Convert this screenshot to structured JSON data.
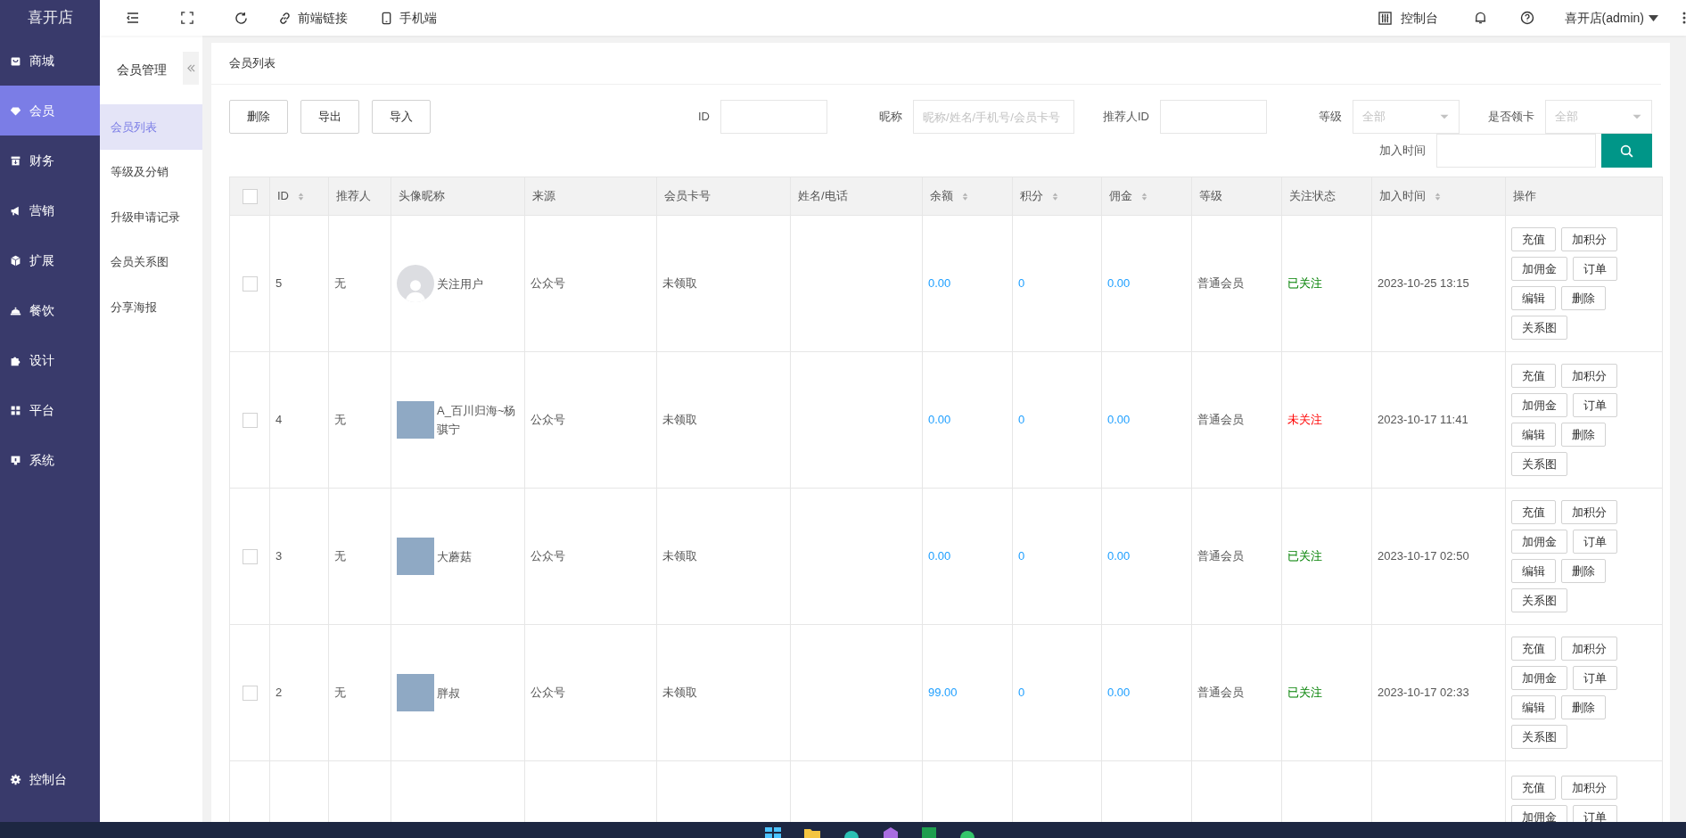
{
  "sidebar": {
    "logo": "喜开店",
    "items": [
      {
        "label": "商城",
        "selected": false
      },
      {
        "label": "会员",
        "selected": true
      },
      {
        "label": "财务",
        "selected": false
      },
      {
        "label": "营销",
        "selected": false
      },
      {
        "label": "扩展",
        "selected": false
      },
      {
        "label": "餐饮",
        "selected": false
      },
      {
        "label": "设计",
        "selected": false
      },
      {
        "label": "平台",
        "selected": false
      },
      {
        "label": "系统",
        "selected": false
      }
    ],
    "footer": "控制台"
  },
  "topbar": {
    "links": [
      "前端链接",
      "手机端"
    ],
    "console": "控制台",
    "user": "喜开店(admin)"
  },
  "submenu": {
    "title": "会员管理",
    "items": [
      {
        "label": "会员列表",
        "selected": true
      },
      {
        "label": "等级及分销",
        "selected": false
      },
      {
        "label": "升级申请记录",
        "selected": false
      },
      {
        "label": "会员关系图",
        "selected": false
      },
      {
        "label": "分享海报",
        "selected": false
      }
    ]
  },
  "card_title": "会员列表",
  "buttons": [
    "删除",
    "导出",
    "导入"
  ],
  "filters": [
    {
      "label": "ID",
      "kind": "input"
    },
    {
      "label": "昵称",
      "kind": "input",
      "placeholder": "昵称/姓名/手机号/会员卡号"
    },
    {
      "label": "推荐人ID",
      "kind": "input"
    },
    {
      "label": "等级",
      "kind": "select",
      "placeholder": "全部"
    },
    {
      "label": "是否领卡",
      "kind": "select",
      "placeholder": "全部"
    },
    {
      "label": "加入时间",
      "kind": "input"
    }
  ],
  "table": {
    "select_all_checked": false,
    "columns": [
      {
        "label": "ID",
        "sortable": true
      },
      {
        "label": "推荐人",
        "sortable": false
      },
      {
        "label": "头像昵称",
        "sortable": false
      },
      {
        "label": "来源",
        "sortable": false
      },
      {
        "label": "会员卡号",
        "sortable": false
      },
      {
        "label": "姓名/电话",
        "sortable": false
      },
      {
        "label": "余额",
        "sortable": true
      },
      {
        "label": "积分",
        "sortable": true
      },
      {
        "label": "佣金",
        "sortable": true
      },
      {
        "label": "等级",
        "sortable": false
      },
      {
        "label": "关注状态",
        "sortable": false
      },
      {
        "label": "加入时间",
        "sortable": true
      },
      {
        "label": "操作",
        "sortable": false
      }
    ],
    "rows": [
      {
        "checked": false,
        "id": "5",
        "referrer": "无",
        "avatar": {
          "kind": "default"
        },
        "nickname": "关注用户",
        "source": "公众号",
        "card": "未领取",
        "balance": "0.00",
        "points": "0",
        "commission": "0.00",
        "level": "普通会员",
        "follow": "已关注",
        "followed": true,
        "joined": "2023-10-25 13:15",
        "actions": [
          "充值",
          "加积分",
          "加佣金",
          "订单",
          "编辑",
          "删除",
          "关系图"
        ]
      },
      {
        "checked": false,
        "id": "4",
        "referrer": "无",
        "avatar": {
          "kind": "photo"
        },
        "nickname": "A_百川归海~杨骐宁",
        "source": "公众号",
        "card": "未领取",
        "balance": "0.00",
        "points": "0",
        "commission": "0.00",
        "level": "普通会员",
        "follow": "未关注",
        "followed": false,
        "joined": "2023-10-17 11:41",
        "actions": [
          "充值",
          "加积分",
          "加佣金",
          "订单",
          "编辑",
          "删除",
          "关系图"
        ]
      },
      {
        "checked": false,
        "id": "3",
        "referrer": "无",
        "avatar": {
          "kind": "photo"
        },
        "nickname": "大蘑菇",
        "source": "公众号",
        "card": "未领取",
        "balance": "0.00",
        "points": "0",
        "commission": "0.00",
        "level": "普通会员",
        "follow": "已关注",
        "followed": true,
        "joined": "2023-10-17 02:50",
        "actions": [
          "充值",
          "加积分",
          "加佣金",
          "订单",
          "编辑",
          "删除",
          "关系图"
        ]
      },
      {
        "checked": false,
        "id": "2",
        "referrer": "无",
        "avatar": {
          "kind": "photo"
        },
        "nickname": "胖叔",
        "source": "公众号",
        "card": "未领取",
        "balance": "99.00",
        "points": "0",
        "commission": "0.00",
        "level": "普通会员",
        "follow": "已关注",
        "followed": true,
        "joined": "2023-10-17 02:33",
        "actions": [
          "充值",
          "加积分",
          "加佣金",
          "订单",
          "编辑",
          "删除",
          "关系图"
        ]
      },
      {
        "actions": [
          "充值",
          "加积分",
          "加佣金",
          "订单"
        ]
      }
    ]
  }
}
